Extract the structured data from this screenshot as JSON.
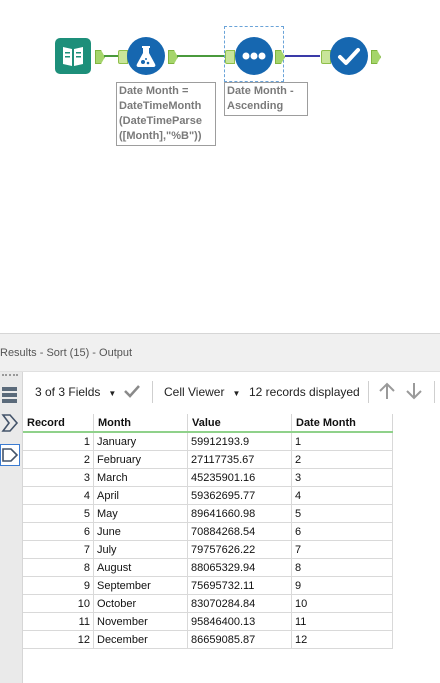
{
  "canvas": {
    "annotations": {
      "formula": "Date Month =\nDateTimeMonth\n(DateTimeParse\n([Month],\"%B\"))",
      "sort": "Date Month -\nAscending"
    },
    "tools": [
      "input-data-tool",
      "formula-tool",
      "sort-tool",
      "browse-tool"
    ],
    "colors": {
      "input": "#1d8f7a",
      "formula": "#1667b0",
      "sort": "#1667b0",
      "browse": "#1667b0",
      "connector": "#4a9a3c",
      "connector_selected": "#3a3aa8"
    }
  },
  "results": {
    "title": "Results - Sort (15) - Output",
    "toolbar": {
      "fields": "3 of 3 Fields",
      "viewer": "Cell Viewer",
      "records": "12 records displayed"
    },
    "columns": [
      "Record",
      "Month",
      "Value",
      "Date Month"
    ],
    "rows": [
      [
        "1",
        "January",
        "59912193.9",
        "1"
      ],
      [
        "2",
        "February",
        "27117735.67",
        "2"
      ],
      [
        "3",
        "March",
        "45235901.16",
        "3"
      ],
      [
        "4",
        "April",
        "59362695.77",
        "4"
      ],
      [
        "5",
        "May",
        "89641660.98",
        "5"
      ],
      [
        "6",
        "June",
        "70884268.54",
        "6"
      ],
      [
        "7",
        "July",
        "79757626.22",
        "7"
      ],
      [
        "8",
        "August",
        "88065329.94",
        "8"
      ],
      [
        "9",
        "September",
        "75695732.11",
        "9"
      ],
      [
        "10",
        "October",
        "83070284.84",
        "10"
      ],
      [
        "11",
        "November",
        "95846400.13",
        "11"
      ],
      [
        "12",
        "December",
        "86659085.87",
        "12"
      ]
    ]
  }
}
